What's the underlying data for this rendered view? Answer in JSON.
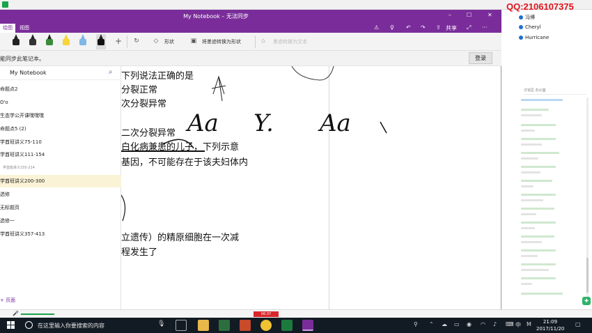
{
  "window": {
    "title": "My Notebook – 无法同步",
    "controls": {
      "min": "–",
      "max": "☐",
      "close": "✕"
    }
  },
  "ribbon": {
    "tabs": [
      {
        "label": "绘图"
      },
      {
        "label": "视图"
      }
    ],
    "share_label": "共享",
    "more_label": "···"
  },
  "toolbar": {
    "shapes_label": "形状",
    "convert_shapes_label": "将墨迹转换为形状",
    "convert_text_label": "墨迹转换为文本",
    "add_label": "+"
  },
  "infobar": {
    "message": "能同步此笔记本。",
    "login_label": "登录"
  },
  "sidebar": {
    "notebook_name": "My Notebook",
    "sections": [
      {
        "label": "命题点2"
      },
      {
        "label": "O'o"
      },
      {
        "label": "生态学公开课嘿嘿嘿"
      },
      {
        "label": "命题点5 (2)"
      },
      {
        "label": "学酋班讲义75-110"
      },
      {
        "label": "学酋班讲义111-154"
      },
      {
        "label": "学酋班讲义155-214"
      },
      {
        "label": "学酋班讲义200-300"
      },
      {
        "label": "选修"
      },
      {
        "label": "无标题页"
      },
      {
        "label": "选修一"
      },
      {
        "label": "学酋班讲义357-413"
      }
    ],
    "add_page_label": "+ 页面"
  },
  "page": {
    "lines": [
      "下列说法正确的是",
      "分裂正常",
      "次分裂异常",
      "二次分裂异常",
      "白化病兼患的儿子，下列示意",
      "基因，不可能存在于该夫妇体内",
      "立遗传）的精原细胞在一次减",
      "程发生了"
    ],
    "ink_text": [
      "Aa",
      "Y.",
      "Aa"
    ]
  },
  "chat": {
    "qq": "QQ:2106107375",
    "users": [
      {
        "name": "冯博"
      },
      {
        "name": "Cheryl"
      },
      {
        "name": "Hurricane"
      }
    ],
    "tabs": "讨论区    办公室"
  },
  "host_bottom": {
    "record_label": "06:37"
  },
  "taskbar": {
    "search_placeholder": "在这里输入你要搜索的内容",
    "ime_label": "中",
    "time": "21:09",
    "date": "2017/11/20"
  },
  "colors": {
    "onenote_purple": "#7a2d9a",
    "qq_red": "#e0121a",
    "selected_section": "#fbf3d6"
  }
}
